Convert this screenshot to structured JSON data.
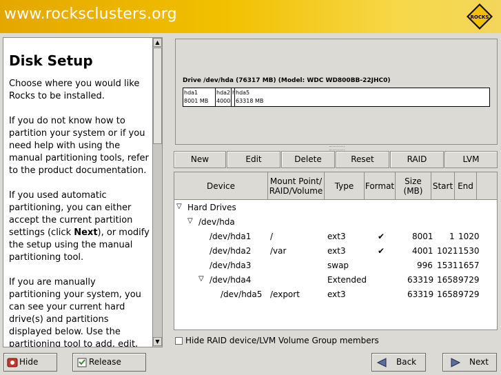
{
  "banner": {
    "url": "www.rocksclusters.org",
    "logo_text": "ROCKS",
    "logo_color": "#f2c000"
  },
  "help": {
    "title": "Disk Setup",
    "p1": "Choose where you would like Rocks to be installed.",
    "p2": "If you do not know how to partition your system or if you need help with using the manual partitioning tools, refer to the product documentation.",
    "p3_a": "If you used automatic partitioning, you can either accept the current partition settings (click ",
    "p3_b": "Next",
    "p3_c": "), or modify the setup using the manual partitioning tool.",
    "p4": "If you are manually partitioning your system, you can see your current hard drive(s) and partitions displayed below. Use the partitioning tool to add, edit,"
  },
  "drive": {
    "title": "Drive /dev/hda (76317 MB) (Model: WDC WD800BB-22JHC0)",
    "segments": [
      {
        "name": "hda1",
        "size": "8001 MB"
      },
      {
        "name": "hda2",
        "size": "4000"
      },
      {
        "name": "h",
        "size": ""
      },
      {
        "name": "hda5",
        "size": "63318 MB"
      }
    ]
  },
  "buttons": {
    "new": "New",
    "edit": "Edit",
    "delete": "Delete",
    "reset": "Reset",
    "raid": "RAID",
    "lvm": "LVM"
  },
  "columns": {
    "device": "Device",
    "mount": "Mount Point/ RAID/Volume",
    "type": "Type",
    "format": "Format",
    "size": "Size (MB)",
    "start": "Start",
    "end": "End"
  },
  "rows": [
    {
      "device": "Hard Drives",
      "mount": "",
      "type": "",
      "format": "",
      "size": "",
      "start": "",
      "end": ""
    },
    {
      "device": "/dev/hda",
      "mount": "",
      "type": "",
      "format": "",
      "size": "",
      "start": "",
      "end": ""
    },
    {
      "device": "/dev/hda1",
      "mount": "/",
      "type": "ext3",
      "format": "✔",
      "size": "8001",
      "start": "1",
      "end": "1020"
    },
    {
      "device": "/dev/hda2",
      "mount": "/var",
      "type": "ext3",
      "format": "✔",
      "size": "4001",
      "start": "1021",
      "end": "1530"
    },
    {
      "device": "/dev/hda3",
      "mount": "",
      "type": "swap",
      "format": "",
      "size": "996",
      "start": "1531",
      "end": "1657"
    },
    {
      "device": "/dev/hda4",
      "mount": "",
      "type": "Extended",
      "format": "",
      "size": "63319",
      "start": "1658",
      "end": "9729"
    },
    {
      "device": "/dev/hda5",
      "mount": "/export",
      "type": "ext3",
      "format": "",
      "size": "63319",
      "start": "1658",
      "end": "9729"
    }
  ],
  "hide_raid_label": "Hide RAID device/LVM Volume Group members",
  "bottom": {
    "hide_help": "Hide Help",
    "release_notes": "Release Notes",
    "back": "Back",
    "next": "Next"
  }
}
